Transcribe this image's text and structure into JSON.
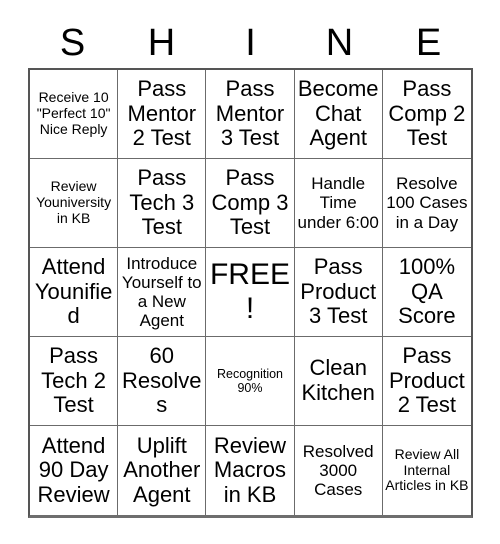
{
  "card": {
    "title_letters": [
      "S",
      "H",
      "I",
      "N",
      "E"
    ],
    "columns": 5,
    "rows": 5,
    "free_space_index": 12,
    "colors": {
      "background": "#ffffff",
      "text": "#000000",
      "grid_line": "#6b6b6b",
      "outer_border": "#555555"
    },
    "cells": [
      {
        "text": "Receive 10 \"Perfect 10\" Nice Reply",
        "size": "sm"
      },
      {
        "text": "Pass Mentor 2 Test",
        "size": "lg"
      },
      {
        "text": "Pass Mentor 3 Test",
        "size": "lg"
      },
      {
        "text": "Become Chat Agent",
        "size": "lg"
      },
      {
        "text": "Pass Comp 2 Test",
        "size": "lg"
      },
      {
        "text": "Review Youniversity in KB",
        "size": "sm"
      },
      {
        "text": "Pass Tech 3 Test",
        "size": "lg"
      },
      {
        "text": "Pass Comp 3 Test",
        "size": "lg"
      },
      {
        "text": "Handle Time under 6:00",
        "size": "md"
      },
      {
        "text": "Resolve 100 Cases in a Day",
        "size": "md"
      },
      {
        "text": "Attend Younified",
        "size": "lg"
      },
      {
        "text": "Introduce Yourself to a New Agent",
        "size": "md"
      },
      {
        "text": "FREE!",
        "size": "xl"
      },
      {
        "text": "Pass Product 3 Test",
        "size": "lg"
      },
      {
        "text": "100% QA Score",
        "size": "lg"
      },
      {
        "text": "Pass Tech 2 Test",
        "size": "lg"
      },
      {
        "text": "60 Resolves",
        "size": "lg"
      },
      {
        "text": "Recognition 90%",
        "size": "xs"
      },
      {
        "text": "Clean Kitchen",
        "size": "lg"
      },
      {
        "text": "Pass Product 2 Test",
        "size": "lg"
      },
      {
        "text": "Attend 90 Day Review",
        "size": "lg"
      },
      {
        "text": "Uplift Another Agent",
        "size": "lg"
      },
      {
        "text": "Review Macros in KB",
        "size": "lg"
      },
      {
        "text": "Resolved 3000 Cases",
        "size": "md"
      },
      {
        "text": "Review All Internal Articles in KB",
        "size": "sm"
      }
    ]
  }
}
